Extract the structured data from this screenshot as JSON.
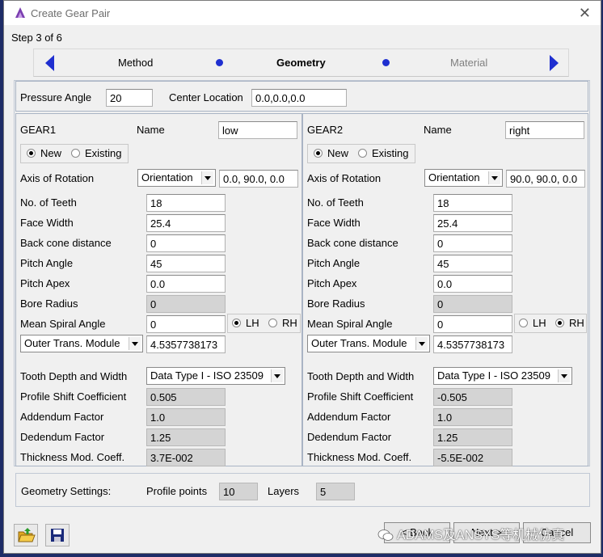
{
  "window": {
    "title": "Create Gear Pair",
    "close_glyph": "✕"
  },
  "step": "Step 3 of 6",
  "nav": {
    "prev": "Method",
    "current": "Geometry",
    "next": "Material"
  },
  "top": {
    "pressure_angle_label": "Pressure Angle",
    "pressure_angle": "20",
    "center_location_label": "Center Location",
    "center_location": "0.0,0.0,0.0"
  },
  "gear1": {
    "title": "GEAR1",
    "name_label": "Name",
    "name": "low",
    "new_label": "New",
    "existing_label": "Existing",
    "axis_label": "Axis of Rotation",
    "axis_mode": "Orientation",
    "axis_value": "0.0, 90.0, 0.0",
    "teeth_label": "No. of Teeth",
    "teeth": "18",
    "face_width_label": "Face Width",
    "face_width": "25.4",
    "back_cone_label": "Back cone distance",
    "back_cone": "0",
    "pitch_angle_label": "Pitch Angle",
    "pitch_angle": "45",
    "pitch_apex_label": "Pitch Apex",
    "pitch_apex": "0.0",
    "bore_label": "Bore Radius",
    "bore": "0",
    "spiral_label": "Mean Spiral Angle",
    "spiral": "0",
    "lh_label": "LH",
    "rh_label": "RH",
    "module_mode": "Outer Trans. Module",
    "module": "4.5357738173",
    "tooth_label": "Tooth Depth and Width",
    "tooth_mode": "Data Type I  - ISO 23509",
    "shift_label": "Profile Shift Coefficient",
    "shift": "0.505",
    "addendum_label": "Addendum Factor",
    "addendum": "1.0",
    "dedendum_label": "Dedendum Factor",
    "dedendum": "1.25",
    "thickness_label": "Thickness Mod. Coeff.",
    "thickness": "3.7E-002"
  },
  "gear2": {
    "title": "GEAR2",
    "name_label": "Name",
    "name": "right",
    "new_label": "New",
    "existing_label": "Existing",
    "axis_label": "Axis of Rotation",
    "axis_mode": "Orientation",
    "axis_value": "90.0, 90.0, 0.0",
    "teeth_label": "No. of Teeth",
    "teeth": "18",
    "face_width_label": "Face Width",
    "face_width": "25.4",
    "back_cone_label": "Back cone distance",
    "back_cone": "0",
    "pitch_angle_label": "Pitch Angle",
    "pitch_angle": "45",
    "pitch_apex_label": "Pitch Apex",
    "pitch_apex": "0.0",
    "bore_label": "Bore Radius",
    "bore": "0",
    "spiral_label": "Mean Spiral Angle",
    "spiral": "0",
    "lh_label": "LH",
    "rh_label": "RH",
    "module_mode": "Outer Trans. Module",
    "module": "4.5357738173",
    "tooth_label": "Tooth Depth and Width",
    "tooth_mode": "Data Type I  - ISO 23509",
    "shift_label": "Profile Shift Coefficient",
    "shift": "-0.505",
    "addendum_label": "Addendum Factor",
    "addendum": "1.0",
    "dedendum_label": "Dedendum Factor",
    "dedendum": "1.25",
    "thickness_label": "Thickness Mod. Coeff.",
    "thickness": "-5.5E-002"
  },
  "settings": {
    "label": "Geometry Settings:",
    "profile_points_label": "Profile points",
    "profile_points": "10",
    "layers_label": "Layers",
    "layers": "5"
  },
  "footer": {
    "back_label": "< Back",
    "next_label": "Next >",
    "cancel_label": "Cancel",
    "watermark": "ADAMS及ANSYS等机械仿真"
  },
  "colors": {
    "accent": "#1f2fd0",
    "background": "#1e2c66",
    "panel": "#f0f0f0"
  },
  "icons": [
    "app-icon",
    "close-icon",
    "prev-arrow-icon",
    "next-arrow-icon",
    "open-folder-icon",
    "save-disk-icon",
    "wechat-icon"
  ]
}
